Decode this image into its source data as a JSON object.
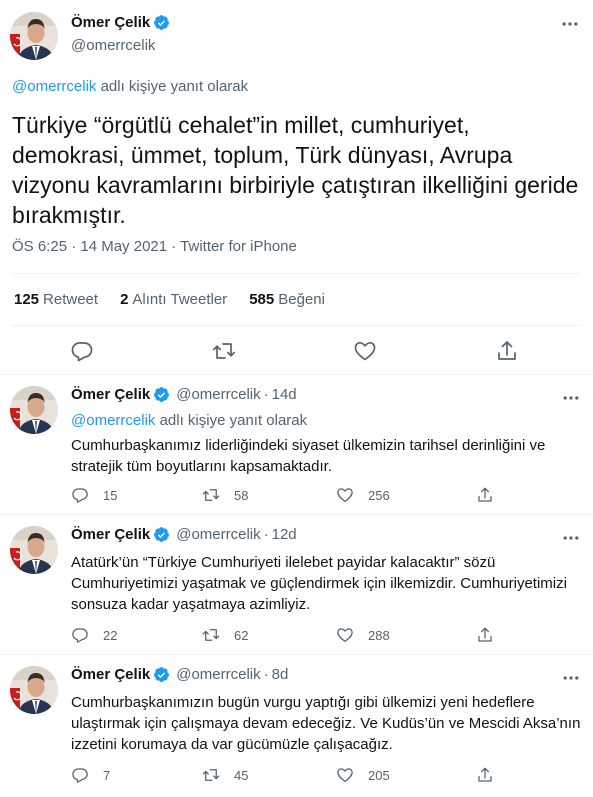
{
  "main_tweet": {
    "author_name": "Ömer Çelik",
    "author_handle": "@omerrcelik",
    "reply_prefix": "@omerrcelik",
    "reply_suffix": "adlı kişiye yanıt olarak",
    "text": "Türkiye “örgütlü cehalet”in millet, cumhuriyet, demokrasi, ümmet, toplum, Türk dünyası, Avrupa vizyonu kavramlarını birbiriyle çatıştıran ilkelliğini geride bırakmıştır.",
    "meta": "ÖS 6:25 · 14 May 2021 · Twitter for iPhone",
    "stats": {
      "retweets_count": "125",
      "retweets_label": "Retweet",
      "quotes_count": "2",
      "quotes_label": "Alıntı Tweetler",
      "likes_count": "585",
      "likes_label": "Beğeni"
    },
    "actions": [
      "reply-icon",
      "retweet-icon",
      "like-icon",
      "share-icon"
    ]
  },
  "replies": [
    {
      "author_name": "Ömer Çelik",
      "author_handle": "@omerrcelik",
      "time": "14d",
      "has_reply_context": true,
      "reply_prefix": "@omerrcelik",
      "reply_suffix": "adlı kişiye yanıt olarak",
      "text": "Cumhurbaşkanımız liderliğindeki siyaset ülkemizin tarihsel derinliğini ve stratejik tüm boyutlarını kapsamaktadır.",
      "replies_count": "15",
      "retweets_count": "58",
      "likes_count": "256"
    },
    {
      "author_name": "Ömer Çelik",
      "author_handle": "@omerrcelik",
      "time": "12d",
      "has_reply_context": false,
      "text": "Atatürk’ün “Türkiye Cumhuriyeti ilelebet payidar kalacaktır” sözü Cumhuriyetimizi yaşatmak ve güçlendirmek için ilkemizdir. Cumhuriyetimizi sonsuza kadar yaşatmaya azimliyiz.",
      "replies_count": "22",
      "retweets_count": "62",
      "likes_count": "288"
    },
    {
      "author_name": "Ömer Çelik",
      "author_handle": "@omerrcelik",
      "time": "8d",
      "has_reply_context": false,
      "text": "Cumhurbaşkanımızın bugün vurgu yaptığı gibi ülkemizi yeni hedeflere ulaştırmak için çalışmaya devam edeceğiz.  Ve Kudüs’ün ve Mescidi Aksa’nın izzetini korumaya da var gücümüzle çalışacağız.",
      "replies_count": "7",
      "retweets_count": "45",
      "likes_count": "205"
    }
  ],
  "colors": {
    "accent": "#1d9bf0",
    "text_primary": "#0f1419",
    "text_secondary": "#536471",
    "divider": "#eff3f4"
  }
}
